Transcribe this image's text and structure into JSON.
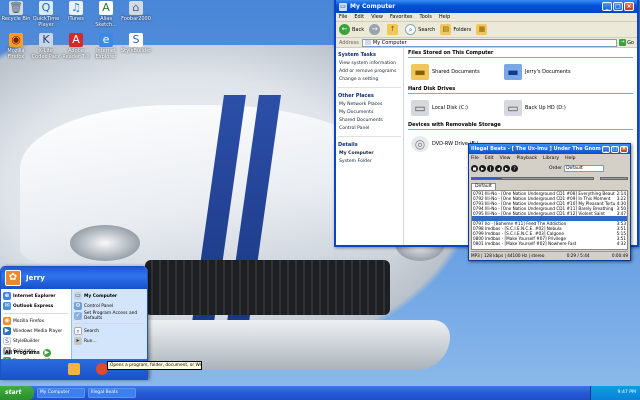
{
  "desktop": {
    "icons": [
      {
        "label": "Recycle Bin",
        "glyph": "🗑",
        "cls": "trash"
      },
      {
        "label": "QuickTime Player",
        "glyph": "Q",
        "cls": "qt"
      },
      {
        "label": "iTunes",
        "glyph": "♫",
        "cls": "it"
      },
      {
        "label": "Alias Sketch...",
        "glyph": "A",
        "cls": "alias"
      },
      {
        "label": "Foobar2000",
        "glyph": "⌂",
        "cls": "trash"
      },
      {
        "label": "Mozilla Firefox",
        "glyph": "◉",
        "cls": "fire"
      },
      {
        "label": "K-Lite Codec Pack",
        "glyph": "K",
        "cls": "kp"
      },
      {
        "label": "Adobe Reader 7.0",
        "glyph": "A",
        "cls": "reader"
      },
      {
        "label": "Internet Explorer",
        "glyph": "e",
        "cls": "ie"
      },
      {
        "label": "StyleBuilder",
        "glyph": "S",
        "cls": "sb"
      }
    ]
  },
  "mycomputer": {
    "title": "My Computer",
    "menu": [
      "File",
      "Edit",
      "View",
      "Favorites",
      "Tools",
      "Help"
    ],
    "toolbar": {
      "back": "Back",
      "search": "Search",
      "folders": "Folders"
    },
    "address": {
      "label": "Address",
      "value": "My Computer",
      "go": "Go"
    },
    "sidebar": {
      "system_tasks": {
        "title": "System Tasks",
        "items": [
          "View system information",
          "Add or remove programs",
          "Change a setting"
        ]
      },
      "other_places": {
        "title": "Other Places",
        "items": [
          "My Network Places",
          "My Documents",
          "Shared Documents",
          "Control Panel"
        ]
      },
      "details": {
        "title": "Details",
        "name": "My Computer",
        "type": "System Folder"
      }
    },
    "sections": {
      "files": {
        "title": "Files Stored on This Computer",
        "items": [
          "Shared Documents",
          "Jerry's Documents"
        ]
      },
      "disks": {
        "title": "Hard Disk Drives",
        "items": [
          "Local Disk (C:)",
          "Back Up HD (D:)"
        ]
      },
      "removable": {
        "title": "Devices with Removable Storage",
        "items": [
          "DVD-RW Drive (E:)"
        ]
      }
    }
  },
  "player": {
    "title": "Illegal Beats - [ The Ux-Imu ] Under The Gnomes",
    "menu": [
      "File",
      "Edit",
      "View",
      "Playback",
      "Library",
      "Help"
    ],
    "order_label": "Order",
    "order_value": "Default",
    "tab": "Default",
    "progress": 0.25,
    "tracks": [
      {
        "text": "0791 Illi-No - [One Nation Underground CD1 #08] Everything Beautiful",
        "dur": "2:14"
      },
      {
        "text": "0792 Illi-No - [One Nation Underground CD1 #09] In This Moment",
        "dur": "3:22"
      },
      {
        "text": "0793 Illi-No - [One Nation Underground CD1 #10] My Pleasant Torture",
        "dur": "4:30"
      },
      {
        "text": "0794 Illi-No - [One Nation Underground CD1 #11] Barely Breathing",
        "dur": "3:50"
      },
      {
        "text": "0795 Illi-No - [One Nation Underground CD1 #12] Violent Saint",
        "dur": "3:47"
      },
      {
        "text": "",
        "dur": "",
        "sel": true
      },
      {
        "text": "0797 Ilo - [Boheme #11] Feed The Addiction",
        "dur": "3:53"
      },
      {
        "text": "0798 Imdbas - [S.C.I.E.N.C.E. #02] Nebula",
        "dur": "3:51"
      },
      {
        "text": "0799 Imdbas - [S.C.I.E.N.C.E. #03] Calgone",
        "dur": "5:15"
      },
      {
        "text": "0800 Imdbas - [Make Yourself #07] Privilege",
        "dur": "3:51"
      },
      {
        "text": "0801 Imdbas - [Make Yourself #02] Nowhere Fast",
        "dur": "4:32"
      }
    ],
    "status_left": "MP3 | 128 kbps | 44100 Hz | stereo",
    "status_mid": "0:29 / 5:44",
    "status_right": "0:00:49"
  },
  "startmenu": {
    "user": "Jerry",
    "left": [
      {
        "label": "Internet Explorer",
        "icon": "ie",
        "glyph": "e",
        "bold": true
      },
      {
        "label": "Outlook Express",
        "icon": "oe",
        "glyph": "✉",
        "bold": true
      },
      {
        "label": "Mozilla Firefox",
        "icon": "ff",
        "glyph": "◉",
        "bold": false
      },
      {
        "label": "Windows Media Player",
        "icon": "wm",
        "glyph": "▶",
        "bold": false
      },
      {
        "label": "StyleBuilder",
        "icon": "sb",
        "glyph": "S",
        "bold": false
      },
      {
        "label": "Calculator",
        "icon": "calc",
        "glyph": "#",
        "bold": false
      },
      {
        "label": "Tour Windows XP",
        "icon": "tour",
        "glyph": "★",
        "bold": false
      }
    ],
    "right": [
      {
        "label": "My Computer",
        "icon": "mc",
        "glyph": "▭",
        "bold": true
      },
      {
        "label": "Control Panel",
        "icon": "cp",
        "glyph": "⚙",
        "bold": false
      },
      {
        "label": "Set Program Access and Defaults",
        "icon": "sp",
        "glyph": "✓",
        "bold": false
      },
      {
        "label": "Search",
        "icon": "se",
        "glyph": "⌕",
        "bold": false
      },
      {
        "label": "Run...",
        "icon": "run",
        "glyph": "▸",
        "bold": false
      }
    ],
    "all_programs": "All Programs"
  },
  "tooltip": "Opens a program, folder, document, or Web site.",
  "taskbar": {
    "start": "start",
    "tasks": [
      "My Computer",
      "Illegal Beats"
    ],
    "clock": "9:47 PM"
  }
}
